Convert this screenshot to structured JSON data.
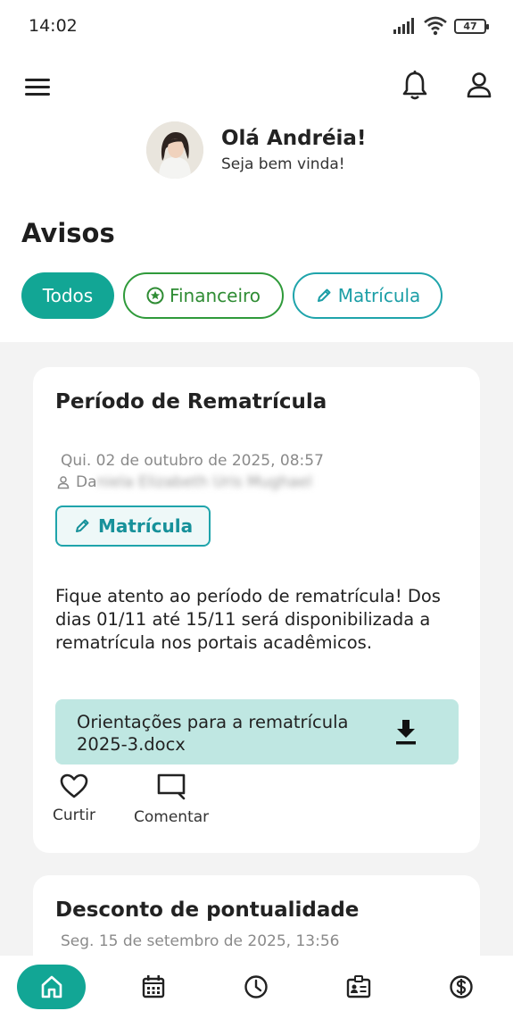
{
  "status": {
    "time": "14:02",
    "battery": "47"
  },
  "header": {
    "greeting": "Olá Andréia!",
    "subtitle": "Seja bem vinda!"
  },
  "section": {
    "title": "Avisos"
  },
  "filters": [
    {
      "label": "Todos"
    },
    {
      "label": "Financeiro"
    },
    {
      "label": "Matrícula"
    }
  ],
  "posts": [
    {
      "title": "Período de Rematrícula",
      "date": "Qui. 02 de outubro de 2025, 08:57",
      "author_prefix": "Da",
      "author_blurred": "niela Elizabeth Uris Mughael",
      "tag": "Matrícula",
      "body": "Fique atento ao período de rematrícula! Dos dias 01/11 até 15/11 será disponibilizada a rematrícula nos portais acadêmicos.",
      "attachment": "Orientações para a rematrícula 2025-3.docx",
      "like_label": "Curtir",
      "comment_label": "Comentar"
    },
    {
      "title": "Desconto de pontualidade",
      "date": "Seg. 15 de setembro de 2025, 13:56"
    }
  ],
  "colors": {
    "accent": "#12a695",
    "financeiro": "#2f9a3a",
    "matricula": "#1fa4ab",
    "attachment_bg": "#bfe7e2"
  },
  "nav": [
    "home-icon",
    "calendar-icon",
    "clock-icon",
    "id-card-icon",
    "dollar-icon"
  ]
}
